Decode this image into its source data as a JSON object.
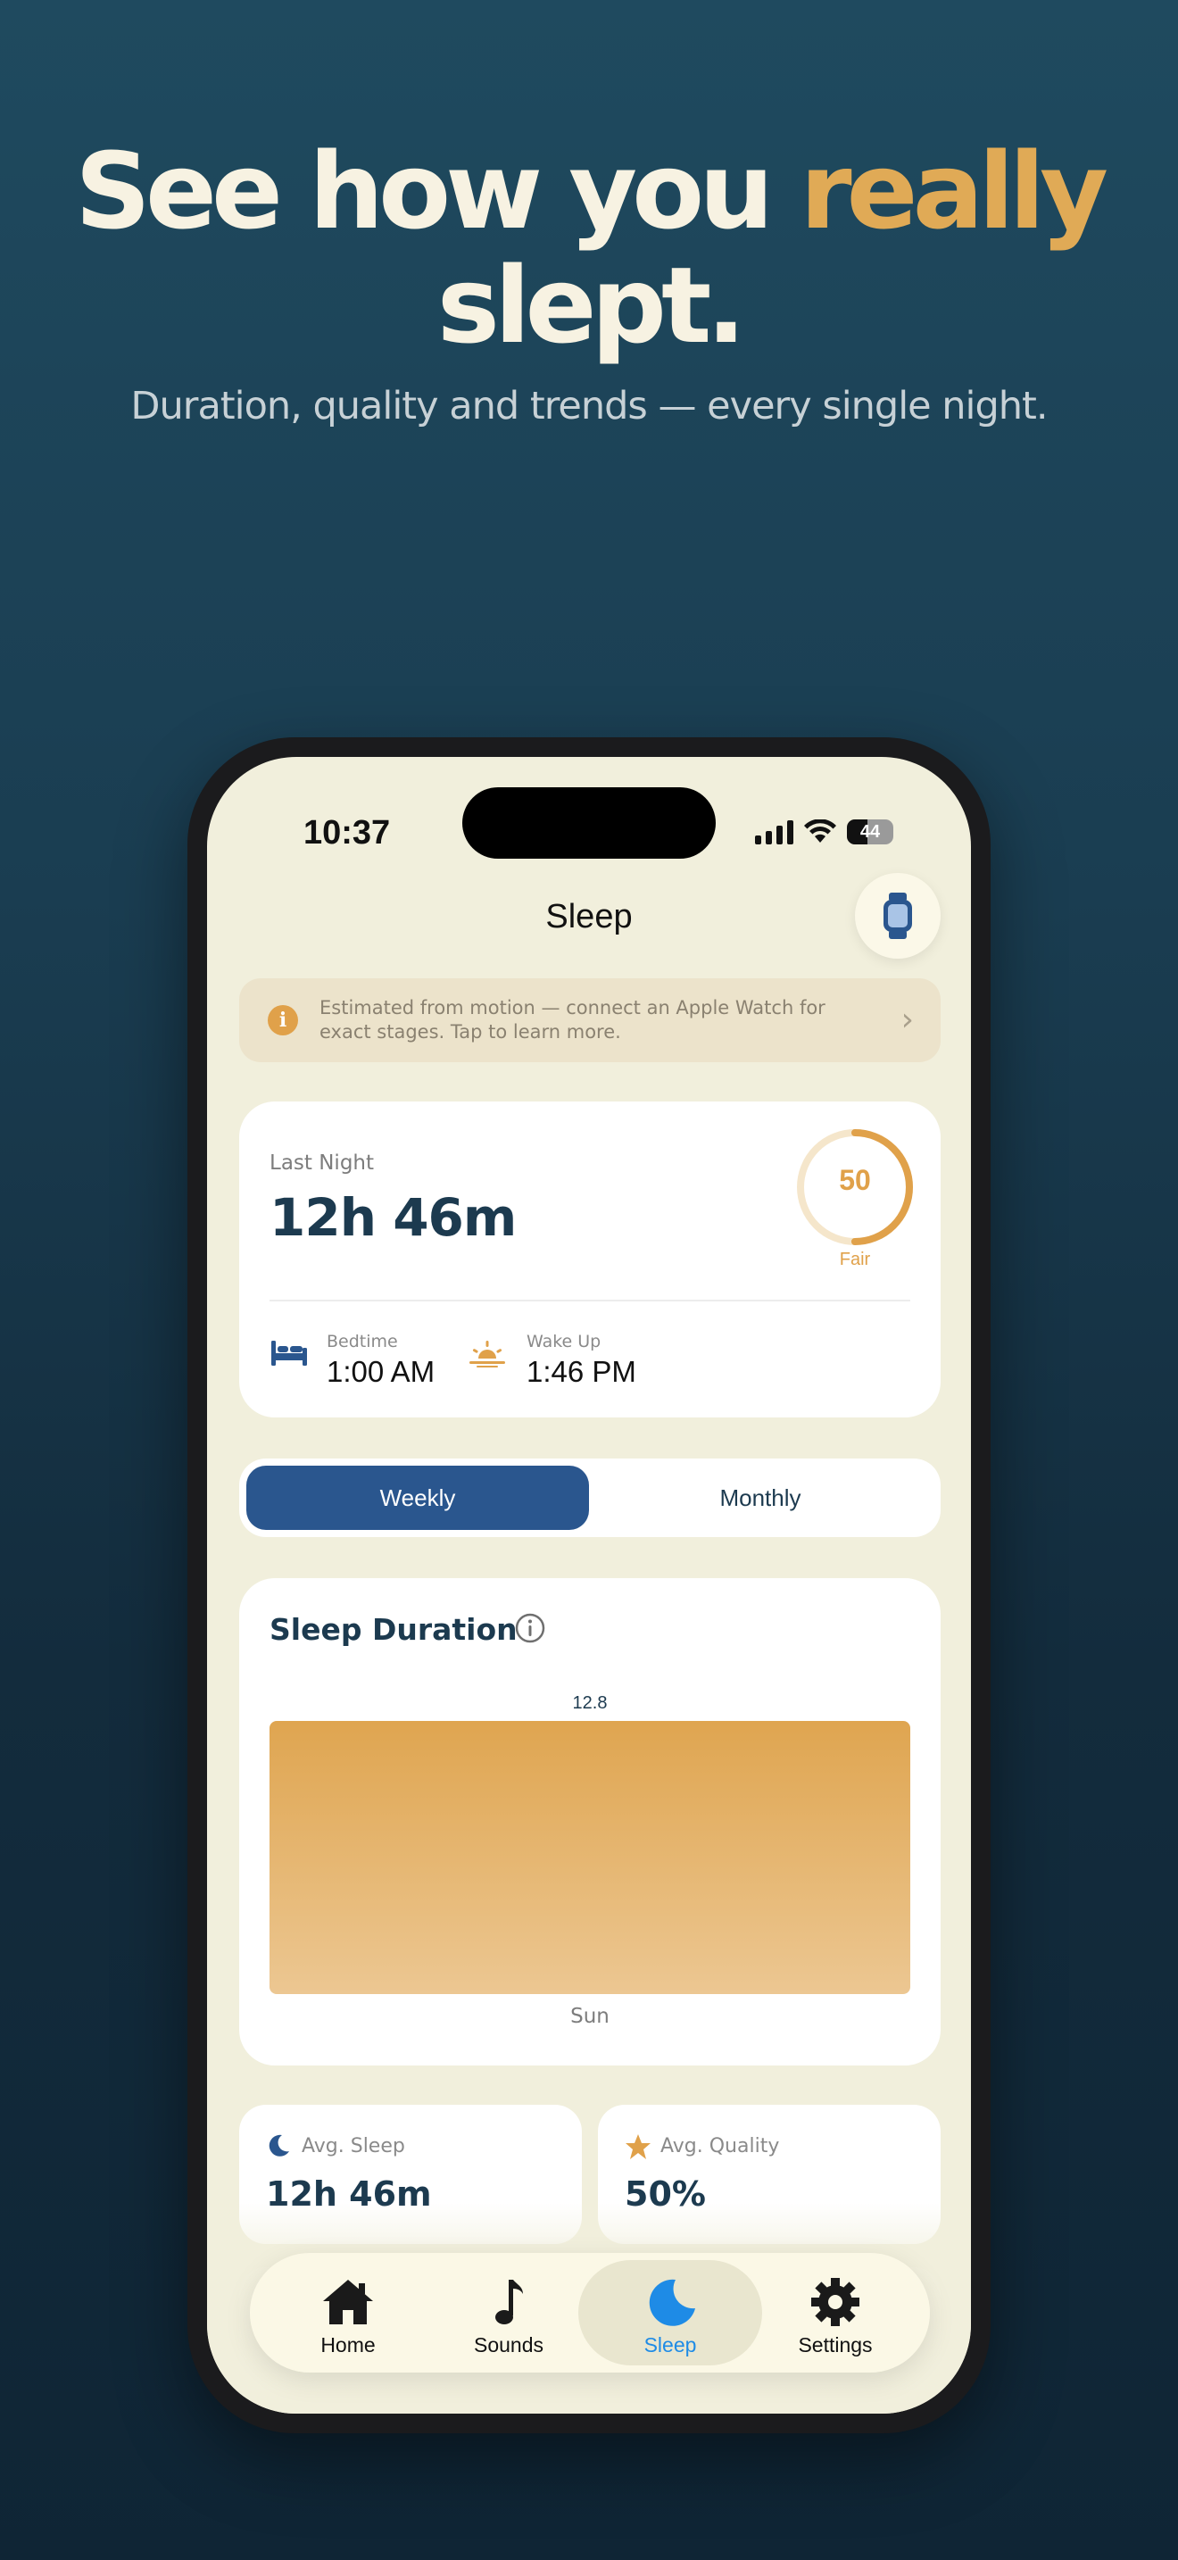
{
  "promo": {
    "headline_part1": "See how you ",
    "headline_accent": "really",
    "headline_part2": "slept.",
    "subhead": "Duration, quality and trends — every single night."
  },
  "status_bar": {
    "time": "10:37",
    "battery": "44"
  },
  "screen": {
    "title": "Sleep",
    "watch_button_icon": "apple-watch-icon"
  },
  "banner": {
    "text": "Estimated from motion — connect an Apple Watch for exact stages. Tap to learn more.",
    "icon": "info-icon"
  },
  "last_night": {
    "label": "Last Night",
    "duration": "12h 46m",
    "score": "50",
    "score_fraction": 0.5,
    "score_label": "Fair",
    "bedtime_label": "Bedtime",
    "bedtime": "1:00 AM",
    "wakeup_label": "Wake Up",
    "wakeup": "1:46 PM"
  },
  "segmented": {
    "weekly": "Weekly",
    "monthly": "Monthly",
    "selected": "Weekly"
  },
  "chart_card": {
    "title": "Sleep Duration"
  },
  "chart_data": {
    "type": "bar",
    "categories": [
      "Sun"
    ],
    "values": [
      12.8
    ],
    "data_labels": [
      "12.8"
    ],
    "ylim": [
      0,
      12.8
    ],
    "grid": false,
    "legend": "none"
  },
  "stats": [
    {
      "label": "Avg. Sleep",
      "value": "12h 46m",
      "icon": "moon-icon"
    },
    {
      "label": "Avg. Quality",
      "value": "50%",
      "icon": "star-icon"
    }
  ],
  "tabs": [
    {
      "label": "Home",
      "icon": "house-icon"
    },
    {
      "label": "Sounds",
      "icon": "music-note-icon"
    },
    {
      "label": "Sleep",
      "icon": "moon-icon",
      "active": true
    },
    {
      "label": "Settings",
      "icon": "gear-icon"
    }
  ],
  "colors": {
    "accent_gold": "#e0aa56",
    "navy": "#1c3a4f",
    "active_tab_blue": "#1e8be6",
    "segment_blue": "#2a568e",
    "screen_bg": "#f1efdc"
  }
}
